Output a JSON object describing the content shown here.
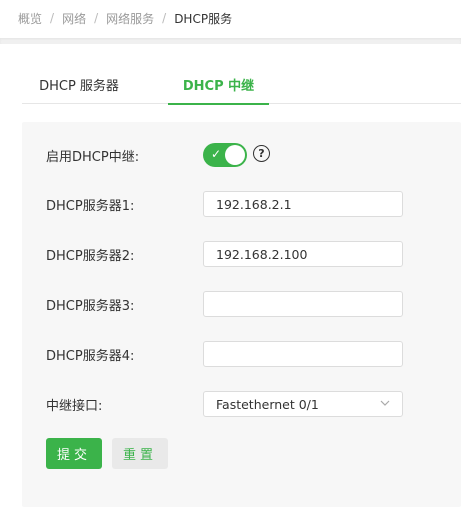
{
  "breadcrumb": {
    "items": [
      "概览",
      "网络",
      "网络服务",
      "DHCP服务"
    ],
    "separator": "/"
  },
  "tabs": [
    {
      "label": "DHCP 服务器",
      "active": false
    },
    {
      "label": "DHCP 中继",
      "active": true
    }
  ],
  "form": {
    "enable": {
      "label": "启用DHCP中继:",
      "on": true,
      "check": "✓",
      "help": "?"
    },
    "server1": {
      "label": "DHCP服务器1:",
      "value": "192.168.2.1"
    },
    "server2": {
      "label": "DHCP服务器2:",
      "value": "192.168.2.100"
    },
    "server3": {
      "label": "DHCP服务器3:",
      "value": ""
    },
    "server4": {
      "label": "DHCP服务器4:",
      "value": ""
    },
    "relay_interface": {
      "label": "中继接口:",
      "value": "Fastethernet 0/1"
    }
  },
  "buttons": {
    "submit": "提交",
    "reset": "重置"
  },
  "colors": {
    "accent": "#3bb34a"
  }
}
